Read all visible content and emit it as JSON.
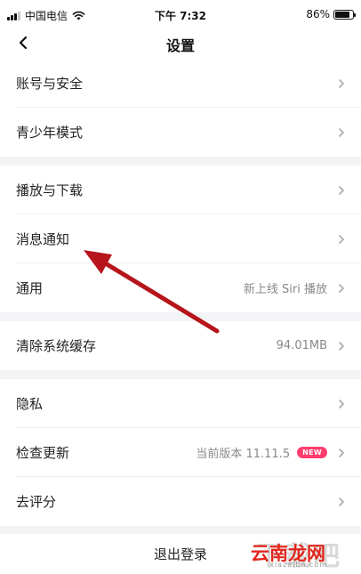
{
  "status_bar": {
    "carrier": "中国电信",
    "time": "下午 7:32",
    "battery_percent": "86%",
    "battery_level": 0.86
  },
  "nav": {
    "back_icon": "chevron-left-icon",
    "title": "设置"
  },
  "groups": [
    {
      "items": [
        {
          "label": "账号与安全",
          "value": ""
        },
        {
          "label": "青少年模式",
          "value": ""
        }
      ]
    },
    {
      "items": [
        {
          "label": "播放与下载",
          "value": ""
        },
        {
          "label": "消息通知",
          "value": ""
        },
        {
          "label": "通用",
          "value": "新上线 Siri 播放"
        }
      ]
    },
    {
      "items": [
        {
          "label": "清除系统缓存",
          "value": "94.01MB"
        }
      ]
    },
    {
      "items": [
        {
          "label": "隐私",
          "value": ""
        },
        {
          "label": "检查更新",
          "value": "当前版本 11.11.5",
          "badge": "NEW"
        },
        {
          "label": "去评分",
          "value": ""
        }
      ]
    }
  ],
  "logout_label": "退出登录",
  "watermark": {
    "main": "云南龙网",
    "sub": "xiazaiba.com",
    "shadow": "下载吧"
  },
  "colors": {
    "badge": "#ff3d6e",
    "arrow": "#b5151b",
    "separator": "#f3f4f6",
    "watermark_red": "#e2271d"
  }
}
